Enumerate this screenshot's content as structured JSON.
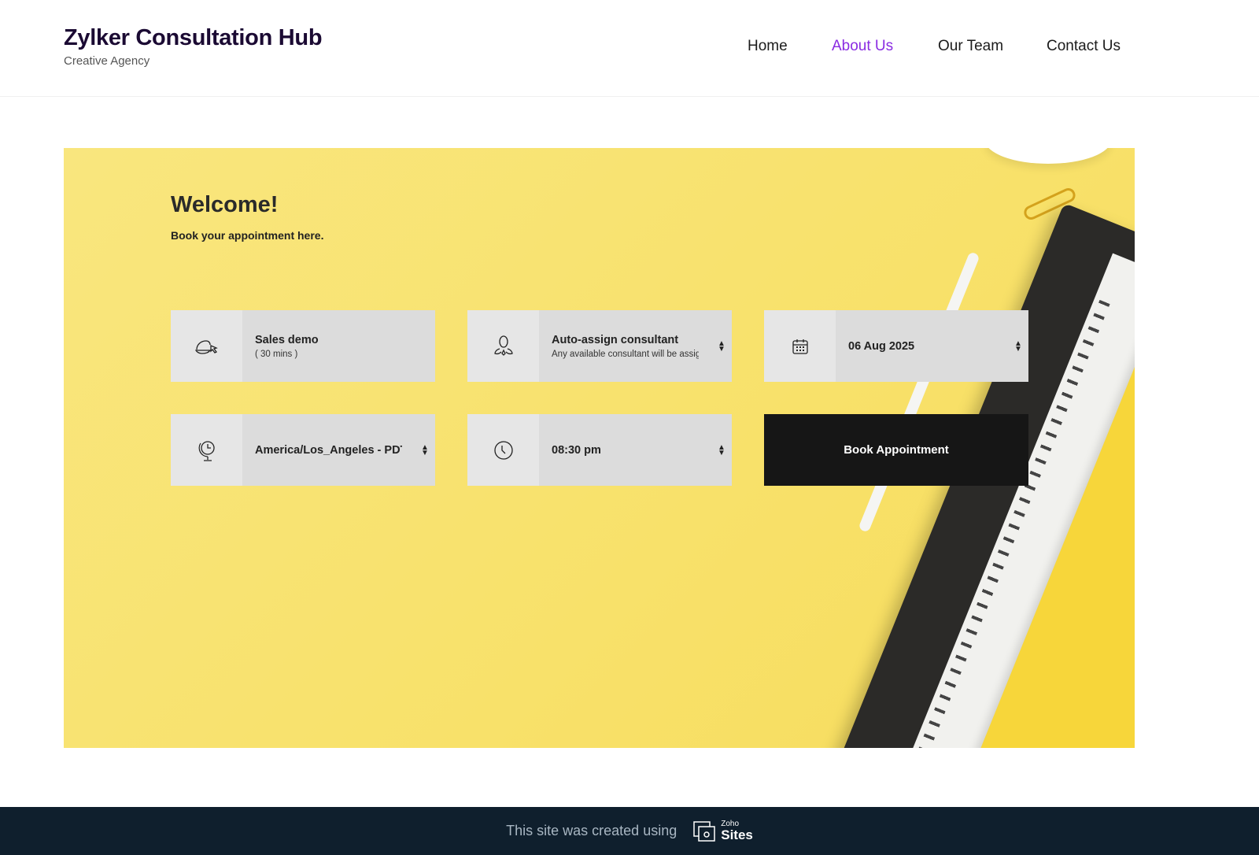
{
  "header": {
    "title": "Zylker Consultation Hub",
    "tagline": "Creative Agency"
  },
  "nav": [
    {
      "label": "Home"
    },
    {
      "label": "About Us",
      "active": true
    },
    {
      "label": "Our Team"
    },
    {
      "label": "Contact Us"
    }
  ],
  "hero": {
    "heading": "Welcome!",
    "subheading": "Book your appointment here."
  },
  "booking": {
    "service": {
      "name": "Sales demo",
      "duration": "( 30 mins )",
      "icon": "service-icon"
    },
    "consultant": {
      "name": "Auto-assign consultant",
      "note": "Any available consultant will be assig...",
      "icon": "consultant-icon"
    },
    "date": {
      "value": "06 Aug 2025",
      "icon": "calendar-icon"
    },
    "timezone": {
      "value": "America/Los_Angeles - PDT (-...",
      "icon": "timezone-icon"
    },
    "time": {
      "value": "08:30 pm",
      "icon": "clock-icon"
    },
    "submit_label": "Book Appointment"
  },
  "footer": {
    "text": "This site was created using",
    "brand_small": "Zoho",
    "brand_big": "Sites"
  },
  "colors": {
    "accent": "#8a2be2",
    "hero_bg": "#f8e274",
    "footer_bg": "#0f1f2d",
    "button": "#161616"
  }
}
